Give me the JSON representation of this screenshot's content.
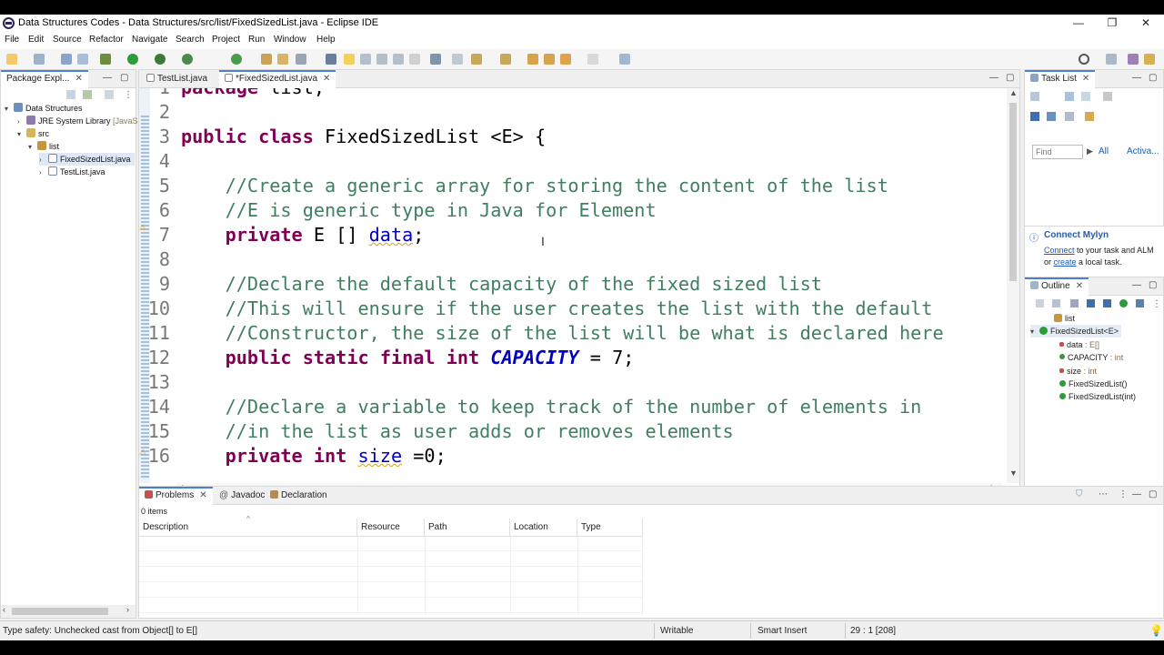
{
  "window": {
    "title": "Data Structures Codes - Data Structures/src/list/FixedSizedList.java - Eclipse IDE",
    "minimize": "—",
    "maximize": "❐",
    "close": "✕"
  },
  "menu": [
    "File",
    "Edit",
    "Source",
    "Refactor",
    "Navigate",
    "Search",
    "Project",
    "Run",
    "Window",
    "Help"
  ],
  "package_explorer": {
    "tab_label": "Package Expl...",
    "items": [
      {
        "label": "Data Structures",
        "icon": "project-icon"
      },
      {
        "label": "JRE System Library",
        "suffix": "[JavaS",
        "icon": "library-icon"
      },
      {
        "label": "src",
        "icon": "source-folder-icon"
      },
      {
        "label": "list",
        "icon": "package-icon"
      },
      {
        "label": "FixedSizedList.java",
        "icon": "java-file-icon"
      },
      {
        "label": "TestList.java",
        "icon": "java-file-icon"
      }
    ]
  },
  "editor": {
    "tabs": [
      {
        "label": "TestList.java",
        "active": false
      },
      {
        "label": "*FixedSizedList.java",
        "active": true
      }
    ],
    "lines": [
      {
        "n": "1",
        "tokens": [
          {
            "t": "package",
            "c": "kw"
          },
          {
            "t": " list;",
            "c": "txt"
          }
        ]
      },
      {
        "n": "2",
        "tokens": []
      },
      {
        "n": "3",
        "tokens": [
          {
            "t": "public",
            "c": "kw"
          },
          {
            "t": " ",
            "c": "txt"
          },
          {
            "t": "class",
            "c": "kw"
          },
          {
            "t": " FixedSizedList <E> {",
            "c": "txt"
          }
        ]
      },
      {
        "n": "4",
        "tokens": []
      },
      {
        "n": "5",
        "tokens": [
          {
            "t": "    //Create a generic array for storing the content of the list",
            "c": "cm"
          }
        ]
      },
      {
        "n": "6",
        "tokens": [
          {
            "t": "    //E is generic type in Java for Element",
            "c": "cm"
          }
        ]
      },
      {
        "n": "7",
        "tokens": [
          {
            "t": "    ",
            "c": "txt"
          },
          {
            "t": "private",
            "c": "kw"
          },
          {
            "t": " E [] ",
            "c": "txt"
          },
          {
            "t": "data",
            "c": "fld warnline"
          },
          {
            "t": ";",
            "c": "txt"
          }
        ]
      },
      {
        "n": "8",
        "tokens": []
      },
      {
        "n": "9",
        "tokens": [
          {
            "t": "    //Declare the default capacity of the fixed sized list",
            "c": "cm"
          }
        ]
      },
      {
        "n": "10",
        "tokens": [
          {
            "t": "    //This will ensure if the user creates the list with the default",
            "c": "cm"
          }
        ]
      },
      {
        "n": "11",
        "tokens": [
          {
            "t": "    //Constructor, the size of the list will be what is declared here",
            "c": "cm"
          }
        ]
      },
      {
        "n": "12",
        "tokens": [
          {
            "t": "    ",
            "c": "txt"
          },
          {
            "t": "public",
            "c": "kw"
          },
          {
            "t": " ",
            "c": "txt"
          },
          {
            "t": "static",
            "c": "kw"
          },
          {
            "t": " ",
            "c": "txt"
          },
          {
            "t": "final",
            "c": "kw"
          },
          {
            "t": " ",
            "c": "txt"
          },
          {
            "t": "int",
            "c": "kw"
          },
          {
            "t": " ",
            "c": "txt"
          },
          {
            "t": "CAPACITY",
            "c": "cst"
          },
          {
            "t": " = 7;",
            "c": "txt"
          }
        ]
      },
      {
        "n": "13",
        "tokens": []
      },
      {
        "n": "14",
        "tokens": [
          {
            "t": "    //Declare a variable to keep track of the number of elements in",
            "c": "cm"
          }
        ]
      },
      {
        "n": "15",
        "tokens": [
          {
            "t": "    //in the list as user adds or removes elements",
            "c": "cm"
          }
        ]
      },
      {
        "n": "16",
        "tokens": [
          {
            "t": "    ",
            "c": "txt"
          },
          {
            "t": "private",
            "c": "kw"
          },
          {
            "t": " ",
            "c": "txt"
          },
          {
            "t": "int",
            "c": "kw"
          },
          {
            "t": " ",
            "c": "txt"
          },
          {
            "t": "size",
            "c": "fld warnline"
          },
          {
            "t": " =0;",
            "c": "txt"
          }
        ]
      }
    ]
  },
  "task_list": {
    "tab_label": "Task List",
    "find_placeholder": "Find",
    "all_label": "All",
    "activate_label": "Activa..."
  },
  "mylyn": {
    "title": "Connect Mylyn",
    "connect_link": "Connect",
    "text1": " to your task and ALM",
    "text2": "or ",
    "create_link": "create",
    "text3": " a local task."
  },
  "outline": {
    "tab_label": "Outline",
    "items": [
      {
        "label": "list",
        "type": "",
        "icon": "package-icon"
      },
      {
        "label": "FixedSizedList<E>",
        "type": "",
        "icon": "class-icon"
      },
      {
        "label": "data",
        "type": " : E[]",
        "icon": "private-field-icon"
      },
      {
        "label": "CAPACITY",
        "type": " : int",
        "icon": "constant-field-icon"
      },
      {
        "label": "size",
        "type": " : int",
        "icon": "private-field-icon"
      },
      {
        "label": "FixedSizedList()",
        "type": "",
        "icon": "constructor-icon"
      },
      {
        "label": "FixedSizedList(int)",
        "type": "",
        "icon": "constructor-icon"
      }
    ]
  },
  "bottom": {
    "tabs": [
      "Problems",
      "Javadoc",
      "Declaration"
    ],
    "count": "0 items",
    "columns": [
      "Description",
      "Resource",
      "Path",
      "Location",
      "Type"
    ]
  },
  "status": {
    "message": "Type safety: Unchecked cast from Object[] to E[]",
    "writable": "Writable",
    "insert_mode": "Smart Insert",
    "position": "29 : 1 [208]"
  },
  "colors": {
    "keyword": "#7f0055",
    "comment": "#3f7f5f",
    "field": "#0000c0",
    "accent": "#4a7fd1"
  }
}
